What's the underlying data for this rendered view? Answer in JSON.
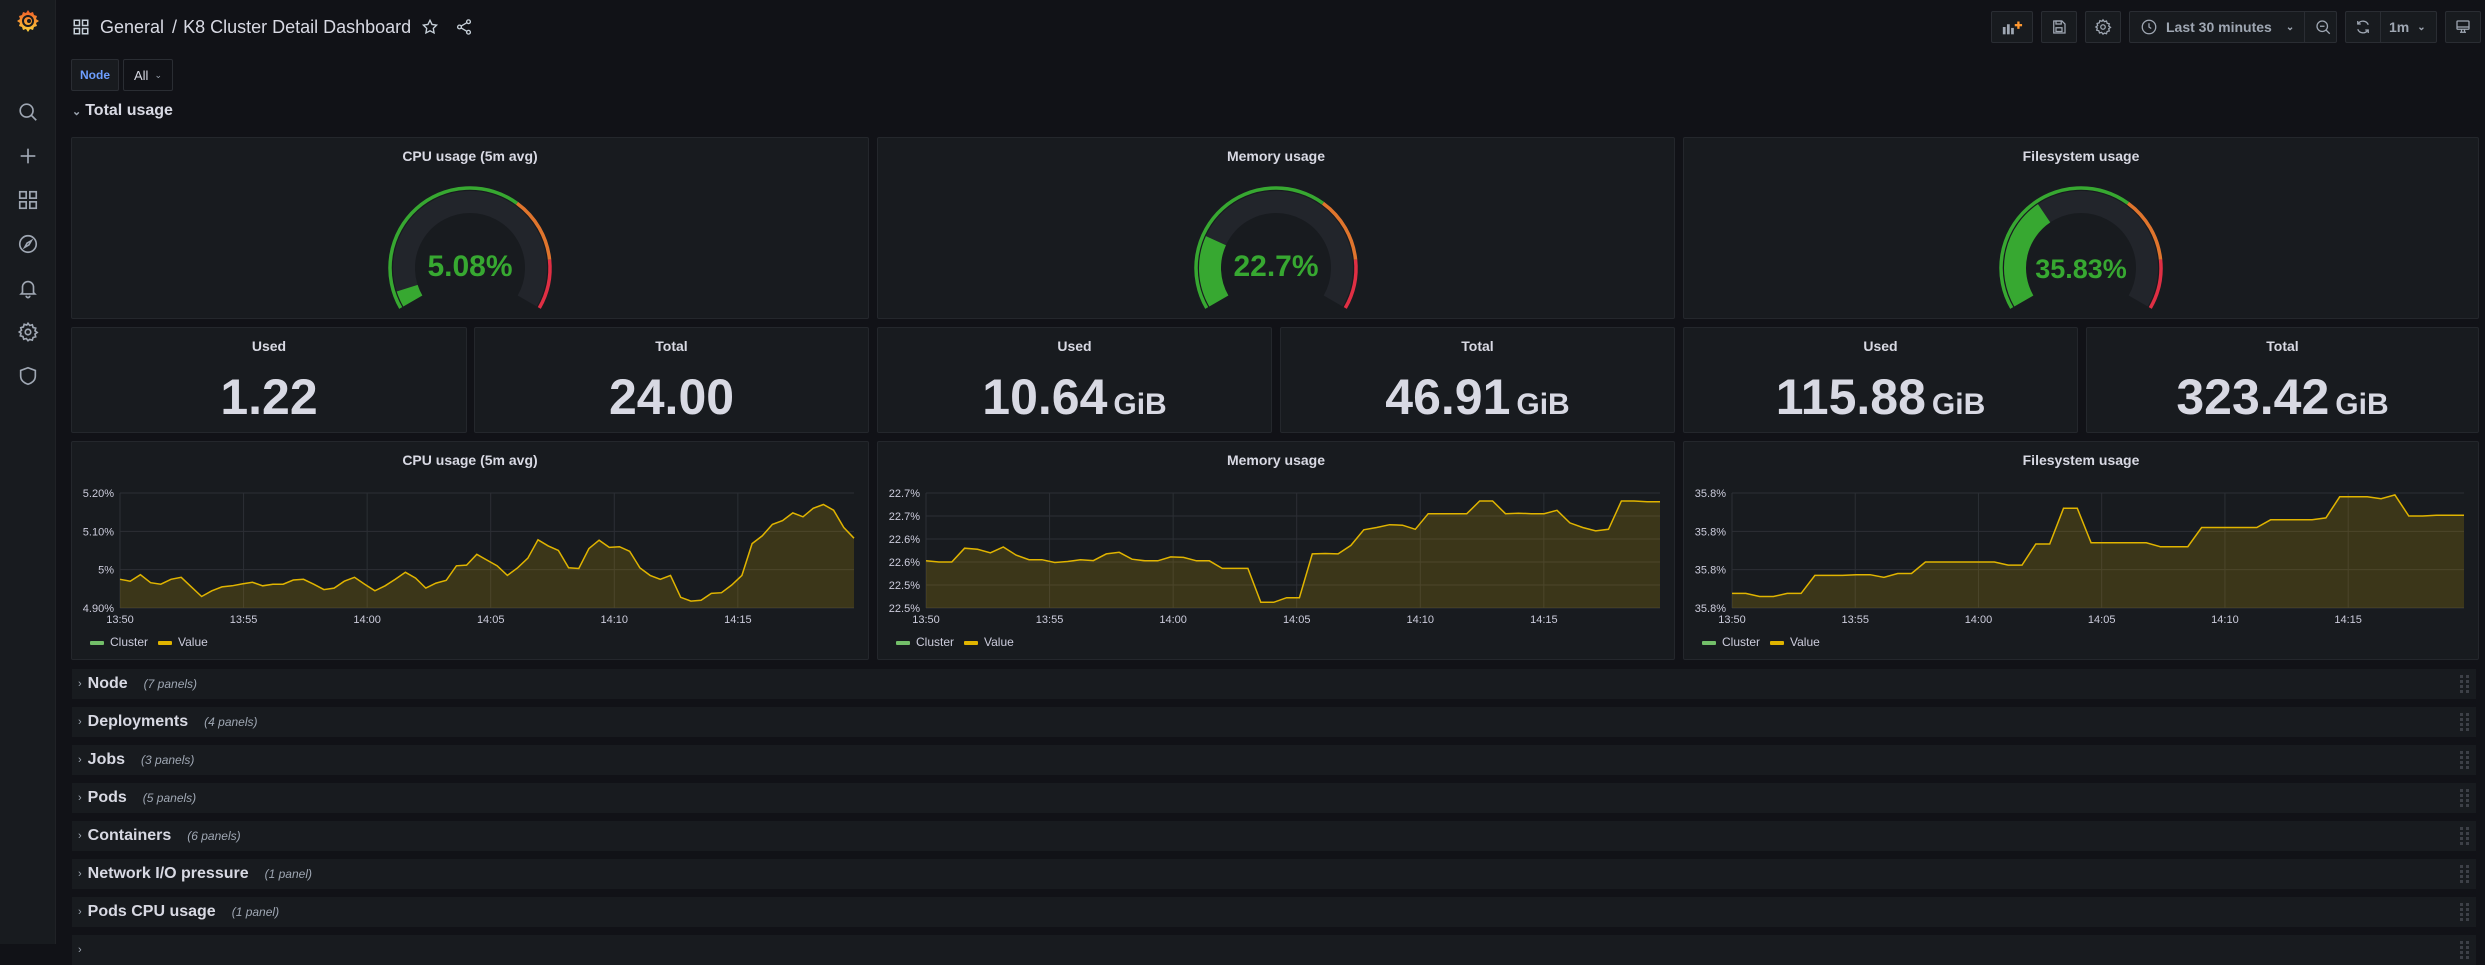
{
  "breadcrumb": {
    "folder": "General",
    "separator": "/",
    "dashboard": "K8 Cluster Detail Dashboard"
  },
  "toolbar": {
    "time_range": "Last 30 minutes",
    "refresh_interval": "1m"
  },
  "variables": [
    {
      "label": "Node",
      "value": "All"
    }
  ],
  "sidebar": {
    "items": [
      {
        "name": "search",
        "icon": "search-icon"
      },
      {
        "name": "create",
        "icon": "plus-icon"
      },
      {
        "name": "dashboards",
        "icon": "dashboards-icon"
      },
      {
        "name": "explore",
        "icon": "compass-icon"
      },
      {
        "name": "alerting",
        "icon": "bell-icon"
      },
      {
        "name": "configuration",
        "icon": "gear-icon"
      },
      {
        "name": "server-admin",
        "icon": "shield-icon"
      }
    ]
  },
  "total_usage_row": {
    "title": "Total usage"
  },
  "gauges": [
    {
      "title": "CPU usage (5m avg)",
      "value": 5.08,
      "display": "5.08%"
    },
    {
      "title": "Memory usage",
      "value": 22.7,
      "display": "22.7%"
    },
    {
      "title": "Filesystem usage",
      "value": 35.83,
      "display": "35.83%"
    }
  ],
  "gauge_thresholds": {
    "green": "#37a831",
    "orange": "#e0752d",
    "red": "#e02f44",
    "orange_from": 65,
    "red_from": 85,
    "min": 0,
    "max": 100
  },
  "stats": [
    {
      "title": "Used",
      "value": "1.22",
      "unit": ""
    },
    {
      "title": "Total",
      "value": "24.00",
      "unit": ""
    },
    {
      "title": "Used",
      "value": "10.64",
      "unit": "GiB"
    },
    {
      "title": "Total",
      "value": "46.91",
      "unit": "GiB"
    },
    {
      "title": "Used",
      "value": "115.88",
      "unit": "GiB"
    },
    {
      "title": "Total",
      "value": "323.42",
      "unit": "GiB"
    }
  ],
  "legend": [
    {
      "name": "Cluster",
      "color": "#73bf69"
    },
    {
      "name": "Value",
      "color": "#e0b400"
    }
  ],
  "chart_data": [
    {
      "type": "area",
      "title": "CPU usage (5m avg)",
      "x_ticks": [
        "13:50",
        "13:55",
        "14:00",
        "14:05",
        "14:10",
        "14:15"
      ],
      "y_ticks": [
        "4.90%",
        "5%",
        "5.10%",
        "5.20%"
      ],
      "y_tick_values": [
        4.9,
        5.0,
        5.1,
        5.2
      ],
      "ylim": [
        4.9,
        5.2
      ],
      "x_range_minutes": [
        0,
        29.7
      ],
      "series": [
        {
          "name": "Value",
          "color": "#e0b400",
          "values": [
            4.975,
            4.97,
            4.987,
            4.966,
            4.962,
            4.975,
            4.98,
            4.955,
            4.93,
            4.945,
            4.955,
            4.958,
            4.963,
            4.967,
            4.958,
            4.962,
            4.962,
            4.973,
            4.975,
            4.962,
            4.948,
            4.952,
            4.97,
            4.98,
            4.962,
            4.945,
            4.958,
            4.975,
            4.993,
            4.978,
            4.952,
            4.965,
            4.972,
            5.01,
            5.012,
            5.04,
            5.025,
            5.01,
            4.985,
            5.005,
            5.03,
            5.078,
            5.062,
            5.05,
            5.005,
            5.003,
            5.055,
            5.077,
            5.058,
            5.06,
            5.048,
            5.005,
            4.985,
            4.975,
            4.985,
            4.928,
            4.918,
            4.92,
            4.938,
            4.94,
            4.96,
            4.985,
            5.068,
            5.088,
            5.118,
            5.128,
            5.148,
            5.138,
            5.16,
            5.17,
            5.155,
            5.11,
            5.082
          ]
        }
      ]
    },
    {
      "type": "area",
      "title": "Memory usage",
      "x_ticks": [
        "13:50",
        "13:55",
        "14:00",
        "14:05",
        "14:10",
        "14:15"
      ],
      "y_ticks": [
        "22.5%",
        "22.5%",
        "22.6%",
        "22.6%",
        "22.7%",
        "22.7%"
      ],
      "y_tick_values": [
        0,
        1,
        2,
        3,
        4,
        5
      ],
      "ylim": [
        0,
        5
      ],
      "x_range_minutes": [
        0,
        29.7
      ],
      "series": [
        {
          "name": "Value",
          "color": "#e0b400",
          "values": [
            2.05,
            2.0,
            2.0,
            2.6,
            2.55,
            2.4,
            2.65,
            2.3,
            2.1,
            2.1,
            1.98,
            2.02,
            2.1,
            2.06,
            2.35,
            2.42,
            2.12,
            2.05,
            2.05,
            2.22,
            2.2,
            2.05,
            2.05,
            1.72,
            1.72,
            1.72,
            0.25,
            0.25,
            0.45,
            0.45,
            2.35,
            2.37,
            2.35,
            2.72,
            3.4,
            3.5,
            3.62,
            3.6,
            3.42,
            4.1,
            4.1,
            4.1,
            4.1,
            4.65,
            4.65,
            4.1,
            4.12,
            4.1,
            4.1,
            4.25,
            3.7,
            3.5,
            3.35,
            3.42,
            4.65,
            4.65,
            4.62,
            4.62
          ]
        }
      ]
    },
    {
      "type": "area",
      "title": "Filesystem usage",
      "x_ticks": [
        "13:50",
        "13:55",
        "14:00",
        "14:05",
        "14:10",
        "14:15"
      ],
      "y_ticks": [
        "35.8%",
        "35.8%",
        "35.8%",
        "35.8%"
      ],
      "y_tick_values": [
        0,
        1,
        2,
        3
      ],
      "ylim": [
        0,
        3
      ],
      "x_range_minutes": [
        0,
        29.7
      ],
      "series": [
        {
          "name": "Value",
          "color": "#e0b400",
          "values": [
            0.38,
            0.38,
            0.3,
            0.3,
            0.38,
            0.38,
            0.85,
            0.85,
            0.85,
            0.87,
            0.87,
            0.8,
            0.9,
            0.9,
            1.2,
            1.2,
            1.2,
            1.2,
            1.2,
            1.2,
            1.12,
            1.12,
            1.67,
            1.67,
            2.6,
            2.6,
            1.7,
            1.7,
            1.7,
            1.7,
            1.7,
            1.6,
            1.6,
            1.6,
            2.1,
            2.1,
            2.1,
            2.1,
            2.1,
            2.3,
            2.3,
            2.3,
            2.3,
            2.35,
            2.9,
            2.9,
            2.9,
            2.85,
            2.95,
            2.4,
            2.4,
            2.42,
            2.42,
            2.42
          ]
        }
      ]
    }
  ],
  "collapsed_rows": [
    {
      "title": "Node",
      "count": "(7 panels)"
    },
    {
      "title": "Deployments",
      "count": "(4 panels)"
    },
    {
      "title": "Jobs",
      "count": "(3 panels)"
    },
    {
      "title": "Pods",
      "count": "(5 panels)"
    },
    {
      "title": "Containers",
      "count": "(6 panels)"
    },
    {
      "title": "Network I/O pressure",
      "count": "(1 panel)"
    },
    {
      "title": "Pods CPU usage",
      "count": "(1 panel)"
    },
    {
      "title": "",
      "count": ""
    }
  ]
}
